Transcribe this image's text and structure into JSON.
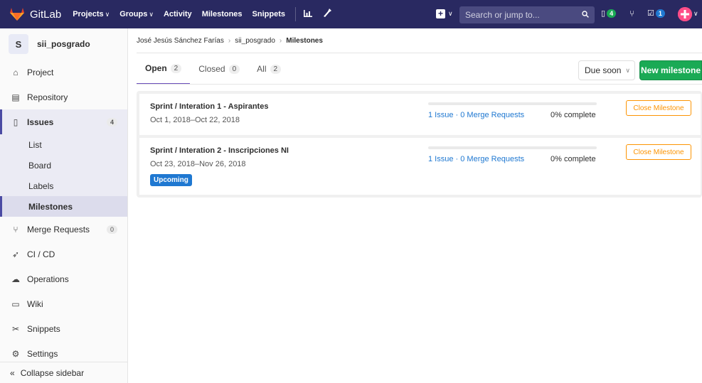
{
  "navbar": {
    "logo_text": "GitLab",
    "links": [
      {
        "label": "Projects",
        "dropdown": true
      },
      {
        "label": "Groups",
        "dropdown": true
      },
      {
        "label": "Activity",
        "dropdown": false
      },
      {
        "label": "Milestones",
        "dropdown": false
      },
      {
        "label": "Snippets",
        "dropdown": false
      }
    ],
    "search_placeholder": "Search or jump to...",
    "todo_count": "4",
    "issues_count": "1",
    "colors": {
      "bg": "#292961",
      "accent": "#1aaa55"
    }
  },
  "sidebar": {
    "project_avatar_letter": "S",
    "project_name": "sii_posgrado",
    "items": [
      {
        "label": "Project",
        "icon": "house-icon"
      },
      {
        "label": "Repository",
        "icon": "doc-icon"
      },
      {
        "label": "Issues",
        "icon": "issues-icon",
        "count": "4",
        "active": true
      },
      {
        "label": "Merge Requests",
        "icon": "merge-icon",
        "count": "0"
      },
      {
        "label": "CI / CD",
        "icon": "rocket-icon"
      },
      {
        "label": "Operations",
        "icon": "cloud-icon"
      },
      {
        "label": "Wiki",
        "icon": "book-icon"
      },
      {
        "label": "Snippets",
        "icon": "scissors-icon"
      },
      {
        "label": "Settings",
        "icon": "gear-icon"
      }
    ],
    "subitems": [
      "List",
      "Board",
      "Labels",
      "Milestones"
    ],
    "collapse_label": "Collapse sidebar"
  },
  "breadcrumb": [
    "José Jesús Sánchez Farías",
    "sii_posgrado",
    "Milestones"
  ],
  "tabs": [
    {
      "label": "Open",
      "count": "2",
      "active": true
    },
    {
      "label": "Closed",
      "count": "0"
    },
    {
      "label": "All",
      "count": "2"
    }
  ],
  "sort": {
    "selected": "Due soon"
  },
  "new_milestone_label": "New milestone",
  "milestones": [
    {
      "title": "Sprint / Interation 1 - Aspirantes",
      "dates": "Oct 1, 2018–Oct 22, 2018",
      "links": "1 Issue · 0 Merge Requests",
      "percent_label": "0% complete",
      "progress": 0,
      "close_label": "Close Milestone"
    },
    {
      "title": "Sprint / Interation 2 - Inscripciones NI",
      "dates": "Oct 23, 2018–Nov 26, 2018",
      "badge": "Upcoming",
      "links": "1 Issue · 0 Merge Requests",
      "percent_label": "0% complete",
      "progress": 0,
      "close_label": "Close Milestone"
    }
  ]
}
